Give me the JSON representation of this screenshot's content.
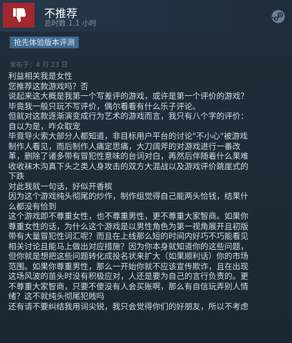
{
  "review": {
    "title": "不推荐",
    "hours": "总时数 1.1 小时",
    "badge": "抢先体验版本评测",
    "posted": "发布于：4 月 23 日",
    "lines": [
      "利益相关我是女性",
      "您推荐这款游戏吗？否",
      "说起来这大概是我第一个写差评的游戏，或许是第一个评价的游戏？",
      "毕竟我一般只玩不写评价，偶尔看看有什么乐子评论。",
      "但就对这款逐渐演变成行为艺术的游戏而言，我只有八个字的评价：",
      "自以为是，咋众取宠",
      "毕竟导火索大部分人都知道，非目标用户平台的讨论\"不小心\"被游戏",
      "制作人看见，而后制作人痛定思痛，大刀阔斧的对游戏进行一番改",
      "革，删除了诸多带有冒犯性意味的台词对白，再然后伴随着什么果难",
      "收收袜木沟真下头之类人身攻击的双方大混战以及游戏评价跳崖式的",
      "下跌",
      "对此我就一句话，好似开香槟",
      "因为这个游戏纯头彻尾的炒作，制作组觉得自己能两头恰钱，结果什",
      "么都没有恰到",
      "这个游戏即不尊重女性，也不尊重男性，更不尊重大家智商。如果你",
      "尊重女性的话，为什么这个游戏是以男性角色为第一视角展开且初版",
      "带有大量冒犯性词汇呢？而且在上线那么短的时间内好巧不巧能看见",
      "相关讨论且能马上做出对应措施？因为你本身就知道你的这些问题，",
      "但你就是想把这些问题转化成投名状来扩大（如果顺利话）你的市场",
      "范围。如果你尊重男性，那么一开始你就不应该宣传欺诈，且在出现",
      "这场风波的苗头时没有积极应对，人还是要为自己的言行负责的。更",
      "不尊重大家智商，只要不傻没有人会买账啊，那么有自信玩弄别人情",
      "绪？这不就纯头彻尾犯贱吗",
      "还有请不要纠结我用词尖锐，我只会觉得你们的好朋友，所以不考虑"
    ]
  },
  "icons": {
    "thumb": "thumbs-down-icon",
    "steam": "steam-logo-icon"
  },
  "colors": {
    "thumb_bg": "#a3282d",
    "badge_bg": "#3f6a8e",
    "page_bg": "#1b2838"
  }
}
